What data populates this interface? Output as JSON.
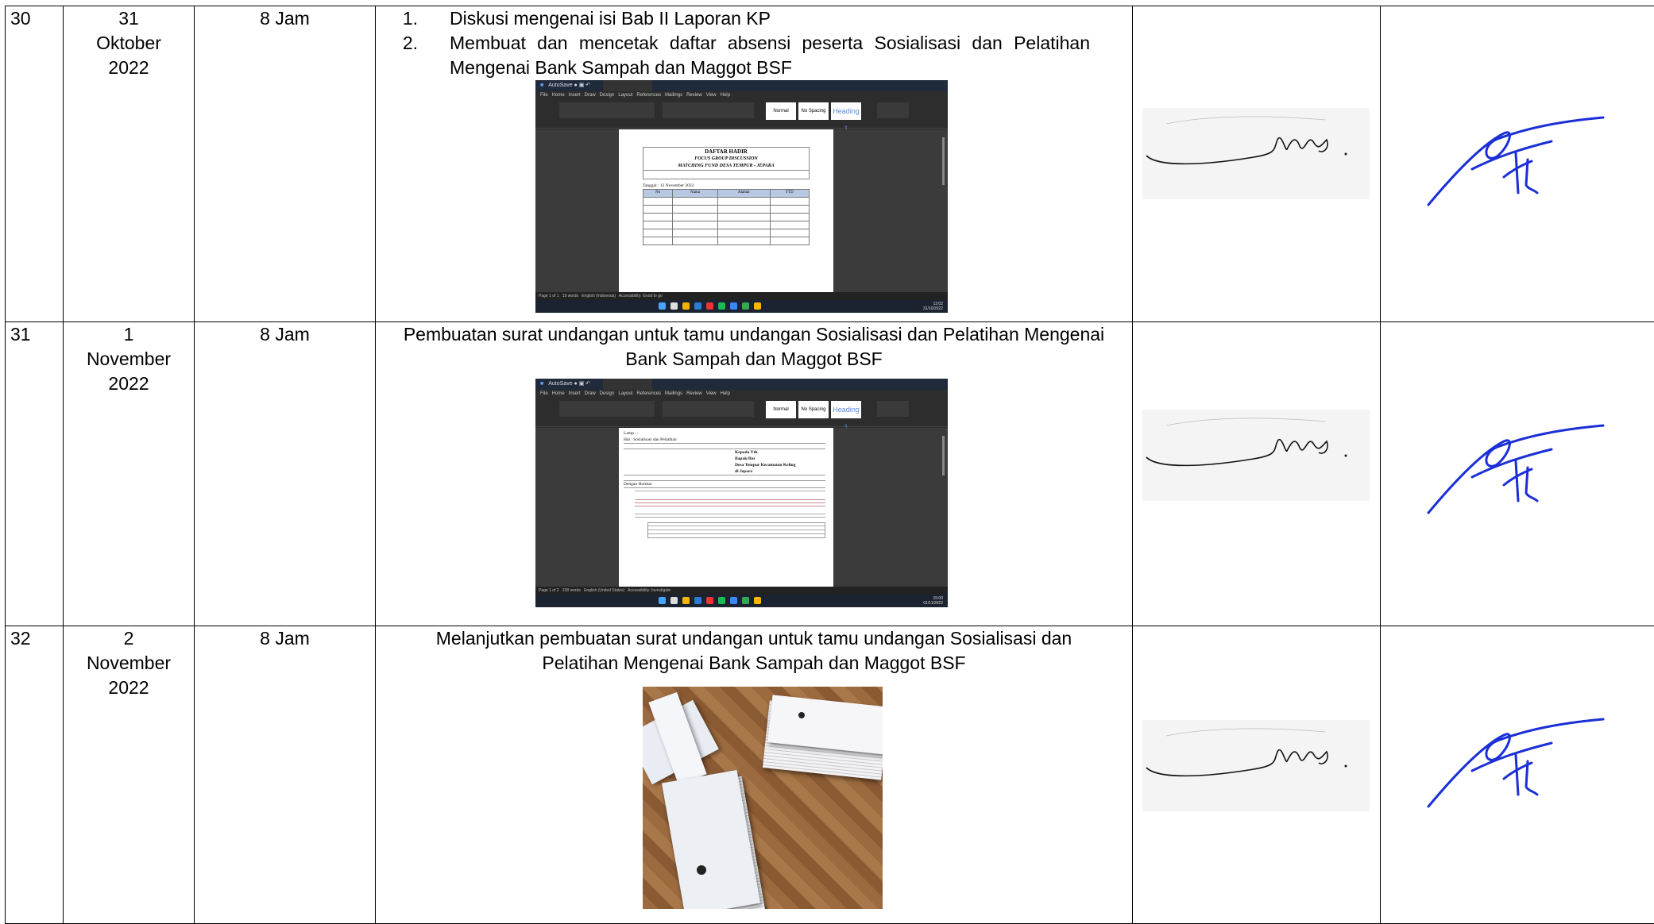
{
  "rows": [
    {
      "no": "30",
      "date": "31 Oktober 2022",
      "duration": "8 Jam",
      "activities": [
        {
          "num": "1.",
          "text": "Diskusi mengenai isi Bab II Laporan KP"
        },
        {
          "num": "2.",
          "text": "Membuat dan mencetak daftar absensi peserta Sosialisasi dan Pelatihan Mengenai Bank Sampah dan Maggot BSF"
        }
      ],
      "screenshot": {
        "doc_title": "DAFTAR HADIR",
        "doc_subtitle_1": "FOCUS GROUP DISCUSSION",
        "doc_subtitle_2": "MATCHING FUND DESA TEMPUR - JEPARA",
        "date_line": "Tanggal : 12 November 2022",
        "columns": [
          "No",
          "Nama",
          "Alamat",
          "TTD"
        ]
      }
    },
    {
      "no": "31",
      "date": "1 November 2022",
      "duration": "8 Jam",
      "activity": "Pembuatan surat undangan untuk tamu undangan Sosialisasi dan Pelatihan Mengenai Bank Sampah dan Maggot BSF",
      "screenshot": {
        "lines": [
          "Lamp : -",
          "Hal : Sosialisasi dan Pelatihan",
          "Kepada Yth.",
          "Bapak/Ibu",
          "Desa Tempur Kecamatan Keling",
          "di Jepara",
          "Dengan Hormat"
        ]
      }
    },
    {
      "no": "32",
      "date": "2 November 2022",
      "duration": "8 Jam",
      "activity": "Melanjutkan pembuatan surat undangan untuk tamu undangan Sosialisasi dan Pelatihan Mengenai Bank Sampah dan Maggot BSF"
    }
  ],
  "signature_colors": {
    "student": "#111111",
    "supervisor": "#1a2fd6"
  }
}
